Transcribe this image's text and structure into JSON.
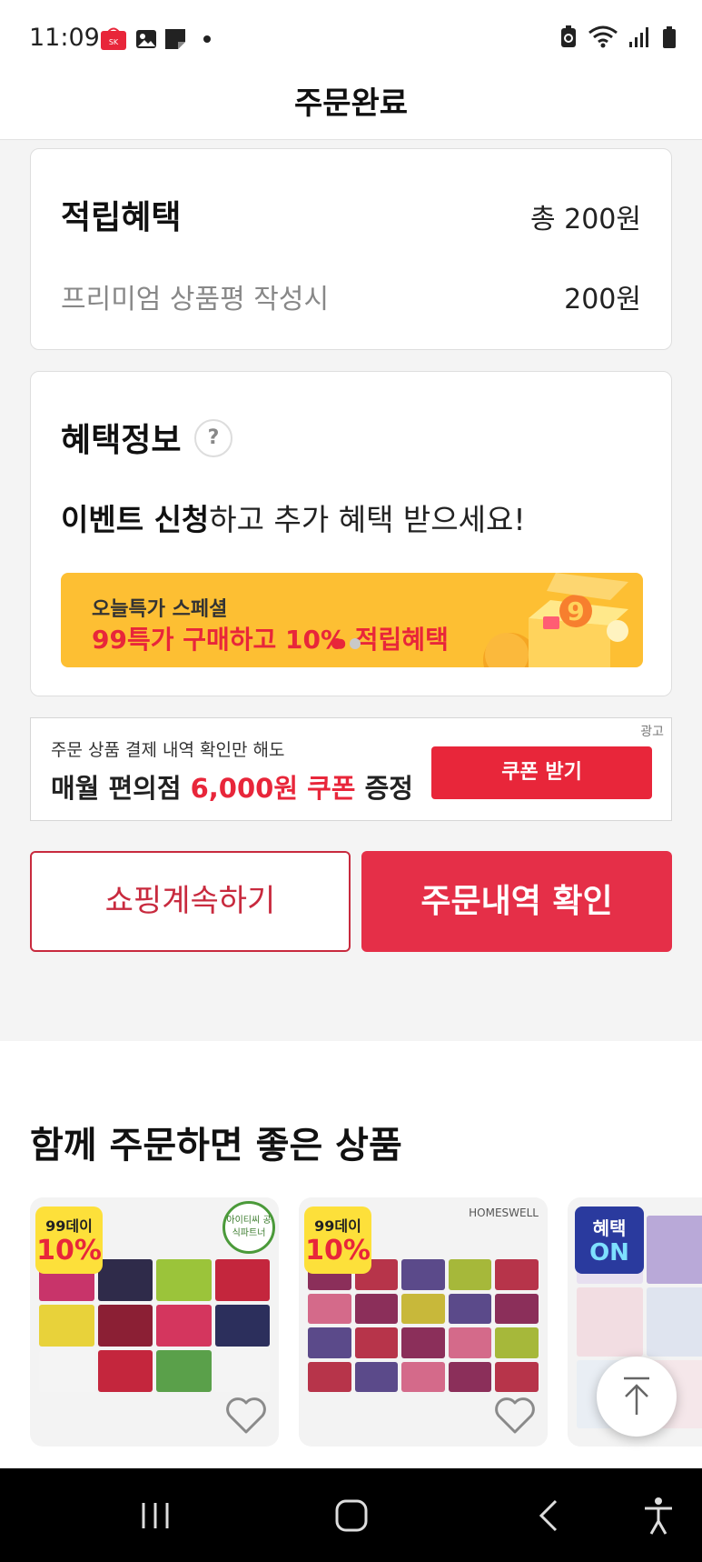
{
  "status_bar": {
    "time": "11:09",
    "left_icons": [
      "sk-stoa-icon",
      "gallery-icon",
      "note-icon",
      "dot-icon"
    ],
    "right_icons": [
      "battery-saver-icon",
      "wifi-icon",
      "signal-icon",
      "battery-icon"
    ]
  },
  "header": {
    "title": "주문완료"
  },
  "reward": {
    "title": "적립혜택",
    "total": "총 200원",
    "row_label": "프리미엄 상품평 작성시",
    "row_value": "200원"
  },
  "benefit": {
    "title": "혜택정보",
    "help": "?",
    "event_bold": "이벤트 신청",
    "event_rest": "하고 추가 혜택 받으세요!",
    "promo_sub": "오늘특가 스페셜",
    "promo_main": "99특가 구매하고 10% 적립혜택",
    "promo_dots": 2,
    "promo_active_dot": 1
  },
  "ad": {
    "badge": "광고",
    "sub": "주문 상품 결제 내역 확인만 해도",
    "main_prefix": "매월 편의점 ",
    "main_highlight": "6,000원 쿠폰",
    "main_suffix": " 증정",
    "button": "쿠폰 받기"
  },
  "actions": {
    "continue_shopping": "쇼핑계속하기",
    "order_history": "주문내역 확인"
  },
  "recommendations": {
    "title": "함께 주문하면 좋은 상품",
    "products": [
      {
        "badge_top": "99데이",
        "badge_big": "10%",
        "partner": "아이티씨 공식파트너"
      },
      {
        "badge_top": "99데이",
        "badge_big": "10%",
        "brand": "HOMESWELL"
      },
      {
        "on_top": "혜택",
        "on_big": "ON"
      }
    ]
  },
  "colors": {
    "accent_red": "#e8263a",
    "button_red": "#e52f48",
    "promo_yellow": "#fdbf33"
  }
}
